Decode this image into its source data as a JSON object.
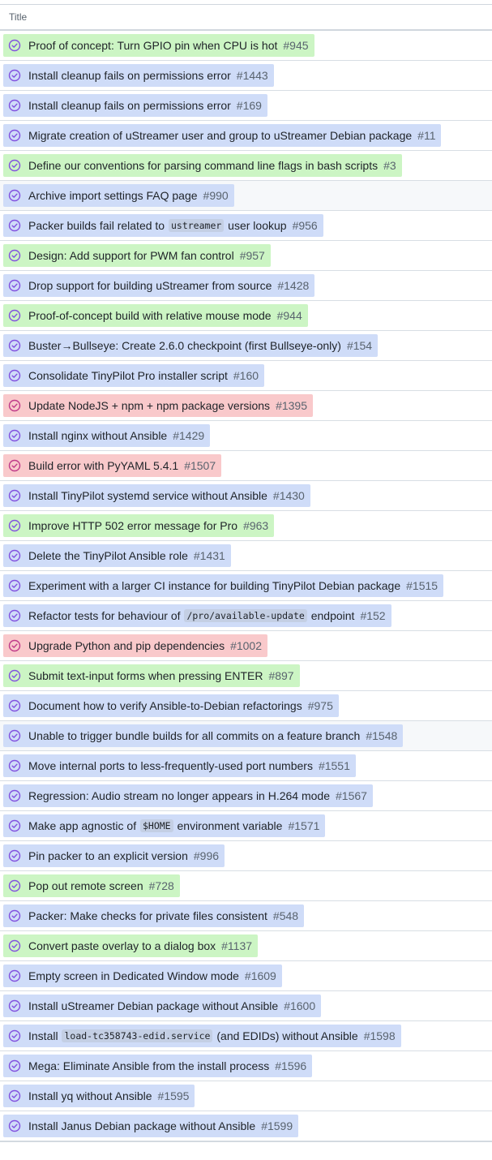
{
  "header": {
    "title": "Title"
  },
  "rows": [
    {
      "color": "green",
      "parts": [
        {
          "t": "Proof of concept: Turn GPIO pin when CPU is hot"
        }
      ],
      "number": "#945"
    },
    {
      "color": "blue",
      "parts": [
        {
          "t": "Install cleanup fails on permissions error"
        }
      ],
      "number": "#1443"
    },
    {
      "color": "blue",
      "parts": [
        {
          "t": "Install cleanup fails on permissions error"
        }
      ],
      "number": "#169"
    },
    {
      "color": "blue",
      "parts": [
        {
          "t": "Migrate creation of uStreamer user and group to uStreamer Debian package"
        }
      ],
      "number": "#11"
    },
    {
      "color": "green",
      "parts": [
        {
          "t": "Define our conventions for parsing command line flags in bash scripts"
        }
      ],
      "number": "#3"
    },
    {
      "color": "blue",
      "hover": true,
      "parts": [
        {
          "t": "Archive import settings FAQ page"
        }
      ],
      "number": "#990"
    },
    {
      "color": "blue",
      "parts": [
        {
          "t": "Packer builds fail related to "
        },
        {
          "c": "ustreamer"
        },
        {
          "t": " user lookup"
        }
      ],
      "number": "#956"
    },
    {
      "color": "green",
      "parts": [
        {
          "t": "Design: Add support for PWM fan control"
        }
      ],
      "number": "#957"
    },
    {
      "color": "blue",
      "parts": [
        {
          "t": "Drop support for building uStreamer from source"
        }
      ],
      "number": "#1428"
    },
    {
      "color": "green",
      "parts": [
        {
          "t": "Proof-of-concept build with relative mouse mode"
        }
      ],
      "number": "#944"
    },
    {
      "color": "blue",
      "parts": [
        {
          "t": "Buster→Bullseye: Create 2.6.0 checkpoint (first Bullseye-only)"
        }
      ],
      "number": "#154"
    },
    {
      "color": "blue",
      "parts": [
        {
          "t": "Consolidate TinyPilot Pro installer script"
        }
      ],
      "number": "#160"
    },
    {
      "color": "red",
      "parts": [
        {
          "t": "Update NodeJS + npm + npm package versions"
        }
      ],
      "number": "#1395"
    },
    {
      "color": "blue",
      "parts": [
        {
          "t": "Install nginx without Ansible"
        }
      ],
      "number": "#1429"
    },
    {
      "color": "red",
      "parts": [
        {
          "t": "Build error with PyYAML 5.4.1"
        }
      ],
      "number": "#1507"
    },
    {
      "color": "blue",
      "parts": [
        {
          "t": "Install TinyPilot systemd service without Ansible"
        }
      ],
      "number": "#1430"
    },
    {
      "color": "green",
      "parts": [
        {
          "t": "Improve HTTP 502 error message for Pro"
        }
      ],
      "number": "#963"
    },
    {
      "color": "blue",
      "parts": [
        {
          "t": "Delete the TinyPilot Ansible role"
        }
      ],
      "number": "#1431"
    },
    {
      "color": "blue",
      "parts": [
        {
          "t": "Experiment with a larger CI instance for building TinyPilot Debian package"
        }
      ],
      "number": "#1515"
    },
    {
      "color": "blue",
      "parts": [
        {
          "t": "Refactor tests for behaviour of "
        },
        {
          "c": "/pro/available-update"
        },
        {
          "t": " endpoint"
        }
      ],
      "number": "#152"
    },
    {
      "color": "red",
      "parts": [
        {
          "t": "Upgrade Python and pip dependencies"
        }
      ],
      "number": "#1002"
    },
    {
      "color": "green",
      "parts": [
        {
          "t": "Submit text-input forms when pressing ENTER"
        }
      ],
      "number": "#897"
    },
    {
      "color": "blue",
      "parts": [
        {
          "t": "Document how to verify Ansible-to-Debian refactorings"
        }
      ],
      "number": "#975"
    },
    {
      "color": "blue",
      "hover": true,
      "parts": [
        {
          "t": "Unable to trigger bundle builds for all commits on a feature branch"
        }
      ],
      "number": "#1548"
    },
    {
      "color": "blue",
      "parts": [
        {
          "t": "Move internal ports to less-frequently-used port numbers"
        }
      ],
      "number": "#1551"
    },
    {
      "color": "blue",
      "parts": [
        {
          "t": "Regression: Audio stream no longer appears in H.264 mode"
        }
      ],
      "number": "#1567"
    },
    {
      "color": "blue",
      "parts": [
        {
          "t": "Make app agnostic of "
        },
        {
          "c": "$HOME"
        },
        {
          "t": " environment variable"
        }
      ],
      "number": "#1571"
    },
    {
      "color": "blue",
      "parts": [
        {
          "t": "Pin packer to an explicit version"
        }
      ],
      "number": "#996"
    },
    {
      "color": "green",
      "parts": [
        {
          "t": "Pop out remote screen"
        }
      ],
      "number": "#728"
    },
    {
      "color": "blue",
      "parts": [
        {
          "t": "Packer: Make checks for private files consistent"
        }
      ],
      "number": "#548"
    },
    {
      "color": "green",
      "parts": [
        {
          "t": "Convert paste overlay to a dialog box"
        }
      ],
      "number": "#1137"
    },
    {
      "color": "blue",
      "parts": [
        {
          "t": "Empty screen in Dedicated Window mode"
        }
      ],
      "number": "#1609"
    },
    {
      "color": "blue",
      "parts": [
        {
          "t": "Install uStreamer Debian package without Ansible"
        }
      ],
      "number": "#1600"
    },
    {
      "color": "blue",
      "parts": [
        {
          "t": "Install "
        },
        {
          "c": "load-tc358743-edid.service"
        },
        {
          "t": " (and EDIDs) without Ansible"
        }
      ],
      "number": "#1598"
    },
    {
      "color": "blue",
      "parts": [
        {
          "t": "Mega: Eliminate Ansible from the install process"
        }
      ],
      "number": "#1596"
    },
    {
      "color": "blue",
      "parts": [
        {
          "t": "Install yq without Ansible"
        }
      ],
      "number": "#1595"
    },
    {
      "color": "blue",
      "parts": [
        {
          "t": "Install Janus Debian package without Ansible"
        }
      ],
      "number": "#1599"
    }
  ],
  "icons": {
    "status": "circle-check-icon"
  },
  "colors": {
    "blue": "#cfdcf8",
    "green": "#ccf5c4",
    "red": "#f9c9cb",
    "icon_purple": "#8250df",
    "icon_pink": "#bf3989"
  }
}
